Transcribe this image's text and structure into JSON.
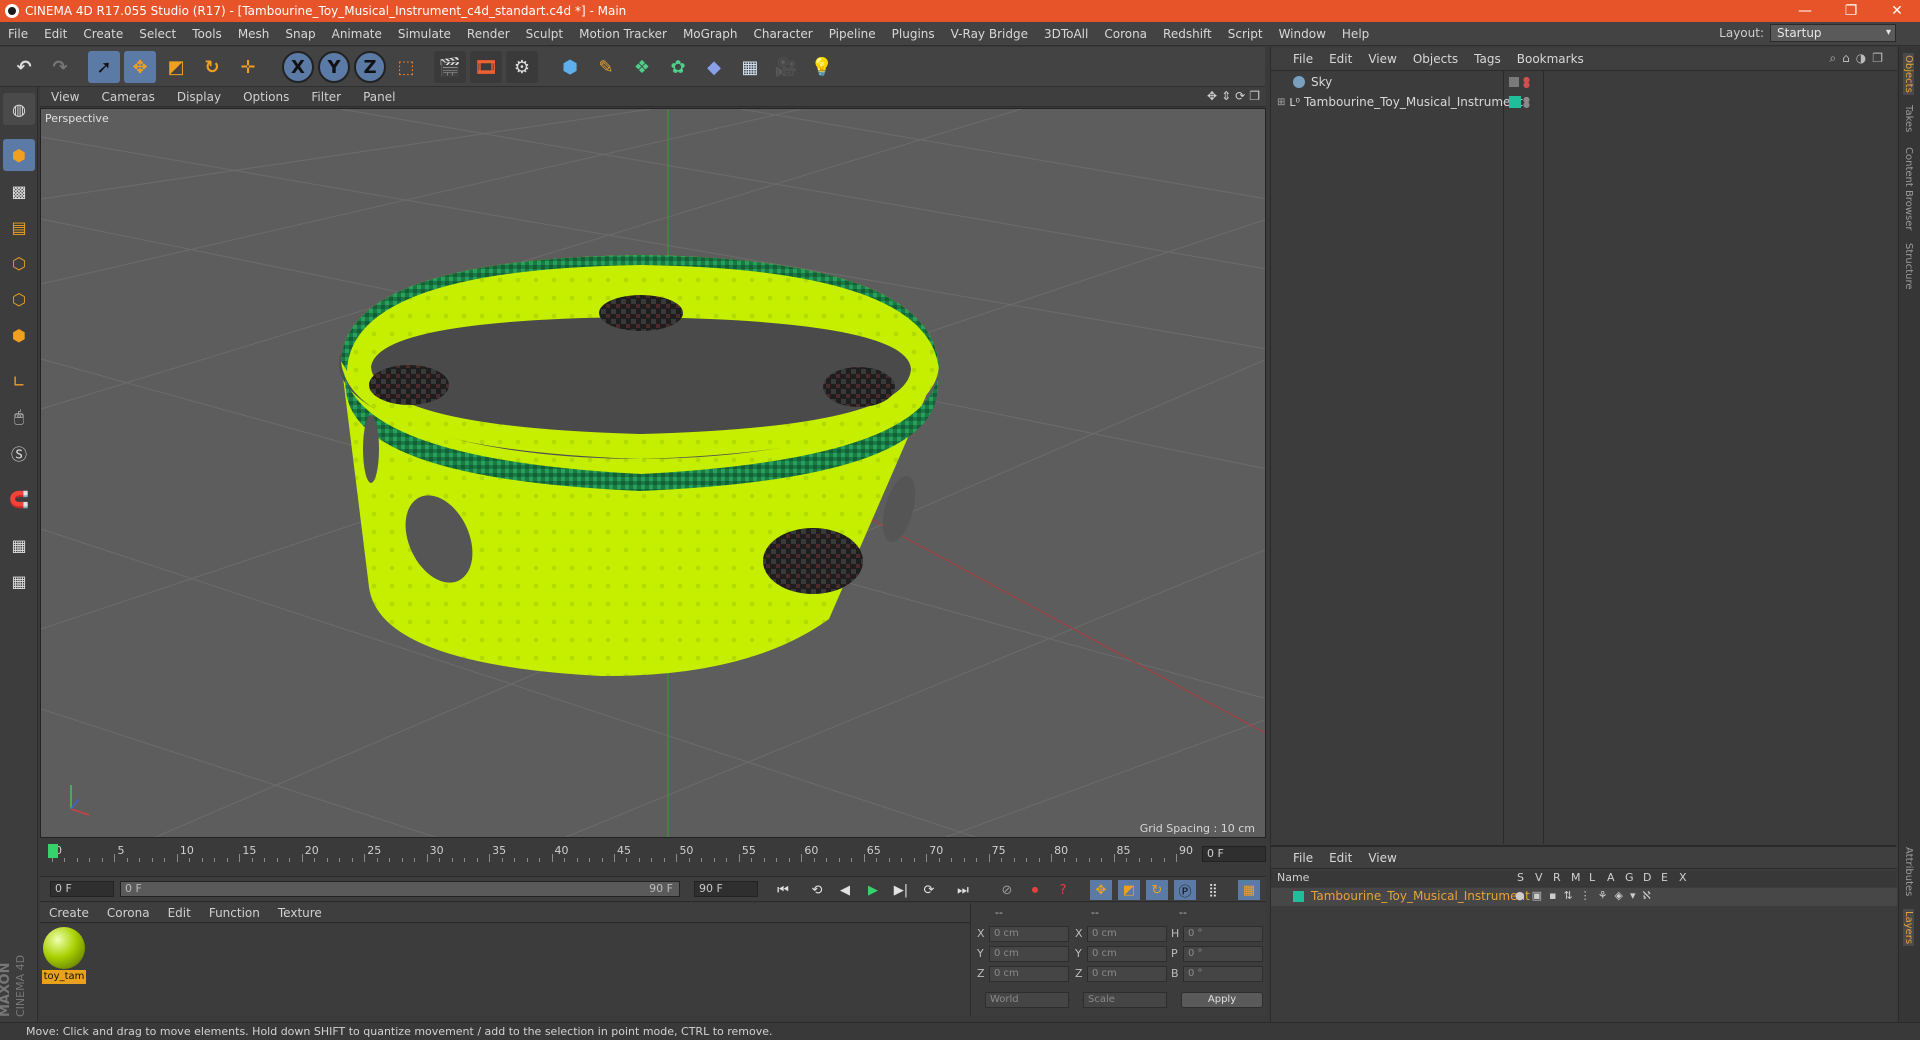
{
  "window": {
    "title": "CINEMA 4D R17.055 Studio (R17) - [Tambourine_Toy_Musical_Instrument_c4d_standart.c4d *] - Main",
    "minimize": "—",
    "restore": "❐",
    "close": "✕"
  },
  "menubar": {
    "items": [
      "File",
      "Edit",
      "Create",
      "Select",
      "Tools",
      "Mesh",
      "Snap",
      "Animate",
      "Simulate",
      "Render",
      "Sculpt",
      "Motion Tracker",
      "MoGraph",
      "Character",
      "Pipeline",
      "Plugins",
      "V-Ray Bridge",
      "3DToAll",
      "Corona",
      "Redshift",
      "Script",
      "Window",
      "Help"
    ],
    "layout_label": "Layout:",
    "layout_value": "Startup"
  },
  "viewport": {
    "menu": [
      "View",
      "Cameras",
      "Display",
      "Options",
      "Filter",
      "Panel"
    ],
    "label": "Perspective",
    "grid_spacing": "Grid Spacing : 10 cm"
  },
  "timeline": {
    "ticks": [
      "0",
      "5",
      "10",
      "15",
      "20",
      "25",
      "30",
      "35",
      "40",
      "45",
      "50",
      "55",
      "60",
      "65",
      "70",
      "75",
      "80",
      "85",
      "90"
    ],
    "current_frame": "0 F"
  },
  "playbar": {
    "start": "0 F",
    "range_start": "0 F",
    "range_end": "90 F",
    "end": "90 F"
  },
  "material_manager": {
    "menu": [
      "Create",
      "Corona",
      "Edit",
      "Function",
      "Texture"
    ],
    "material_name": "toy_tam"
  },
  "coordinates": {
    "headers": [
      "--",
      "--",
      "--"
    ],
    "rows": [
      {
        "a": "X",
        "av": "0 cm",
        "b": "X",
        "bv": "0 cm",
        "c": "H",
        "cv": "0 °"
      },
      {
        "a": "Y",
        "av": "0 cm",
        "b": "Y",
        "bv": "0 cm",
        "c": "P",
        "cv": "0 °"
      },
      {
        "a": "Z",
        "av": "0 cm",
        "b": "Z",
        "bv": "0 cm",
        "c": "B",
        "cv": "0 °"
      }
    ],
    "space": "World",
    "mode": "Scale",
    "apply": "Apply"
  },
  "object_manager": {
    "menu": [
      "File",
      "Edit",
      "View",
      "Objects",
      "Tags",
      "Bookmarks"
    ],
    "objects": [
      {
        "name": "Sky"
      },
      {
        "name": "Tambourine_Toy_Musical_Instrument"
      }
    ]
  },
  "layer_manager": {
    "menu": [
      "File",
      "Edit",
      "View"
    ],
    "columns": [
      "Name",
      "S",
      "V",
      "R",
      "M",
      "L",
      "A",
      "G",
      "D",
      "E",
      "X"
    ],
    "layer_name": "Tambourine_Toy_Musical_Instrument"
  },
  "right_tabs": [
    "Objects",
    "Takes",
    "Content Browser",
    "Structure",
    "Attributes",
    "Layers"
  ],
  "brand": {
    "line1": "MAXON",
    "line2": "CINEMA 4D"
  },
  "status": "Move: Click and drag to move elements. Hold down SHIFT to quantize movement / add to the selection in point mode, CTRL to remove.",
  "colors": {
    "titlebar": "#e8542a",
    "accent": "#5b7aa6",
    "model_yellow": "#c8f000",
    "model_green": "#1c8a4a",
    "layer_teal": "#1fbf9c",
    "layer_name": "#e8a23a"
  }
}
